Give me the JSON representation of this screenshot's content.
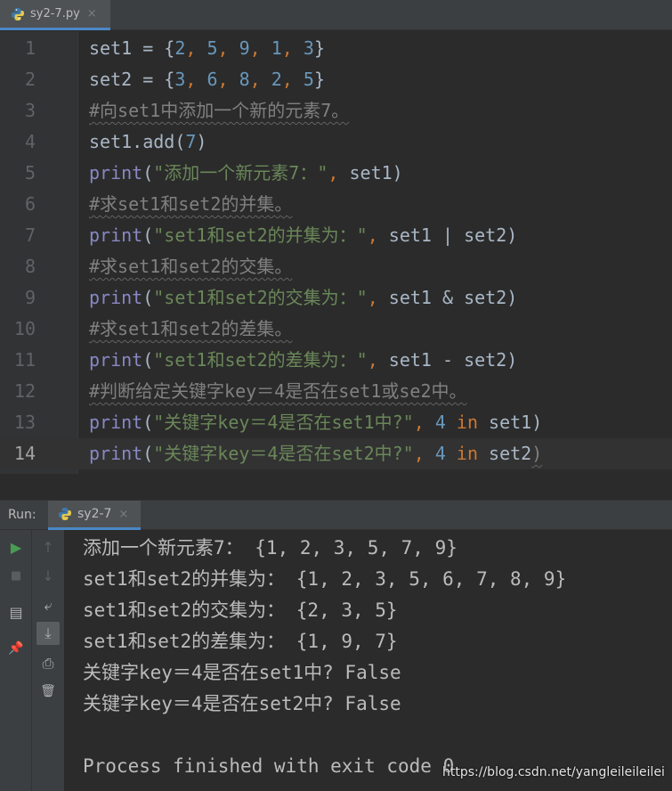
{
  "editor_tab": {
    "title": "sy2-7.py",
    "close": "×",
    "icon": "python-file-icon"
  },
  "code_lines": [
    {
      "num": "1"
    },
    {
      "num": "2"
    },
    {
      "num": "3"
    },
    {
      "num": "4"
    },
    {
      "num": "5"
    },
    {
      "num": "6"
    },
    {
      "num": "7"
    },
    {
      "num": "8"
    },
    {
      "num": "9"
    },
    {
      "num": "10"
    },
    {
      "num": "11"
    },
    {
      "num": "12"
    },
    {
      "num": "13"
    },
    {
      "num": "14"
    }
  ],
  "code": {
    "l1": {
      "a": "set1 = {",
      "n1": "2",
      "c1": ", ",
      "n2": "5",
      "c2": ", ",
      "n3": "9",
      "c3": ", ",
      "n4": "1",
      "c4": ", ",
      "n5": "3",
      "b": "}"
    },
    "l2": {
      "a": "set2 = {",
      "n1": "3",
      "c1": ", ",
      "n2": "6",
      "c2": ", ",
      "n3": "8",
      "c3": ", ",
      "n4": "2",
      "c4": ", ",
      "n5": "5",
      "b": "}"
    },
    "l3": {
      "comment": "#向set1中添加一个新的元素7。"
    },
    "l4": {
      "a": "set1.add(",
      "n": "7",
      "b": ")"
    },
    "l5": {
      "fn": "print",
      "p": "(",
      "s": "\"添加一个新元素7：\"",
      "k": ", ",
      "rest": "set1)"
    },
    "l6": {
      "comment": "#求set1和set2的并集。"
    },
    "l7": {
      "fn": "print",
      "p": "(",
      "s": "\"set1和set2的并集为：\"",
      "k": ", ",
      "rest": "set1 | set2)"
    },
    "l8": {
      "comment": "#求set1和set2的交集。"
    },
    "l9": {
      "fn": "print",
      "p": "(",
      "s": "\"set1和set2的交集为：\"",
      "k": ", ",
      "rest": "set1 & set2)"
    },
    "l10": {
      "comment": "#求set1和set2的差集。"
    },
    "l11": {
      "fn": "print",
      "p": "(",
      "s": "\"set1和set2的差集为：\"",
      "k": ", ",
      "rest": "set1 - set2)"
    },
    "l12": {
      "comment": "#判断给定关键字key＝4是否在set1或se2中。"
    },
    "l13": {
      "fn": "print",
      "p": "(",
      "s": "\"关键字key＝4是否在set1中?\"",
      "k": ", ",
      "n": "4",
      "sp": " ",
      "kw": "in",
      "rest": " set1)"
    },
    "l14": {
      "fn": "print",
      "p": "(",
      "s": "\"关键字key＝4是否在set2中?\"",
      "k": ", ",
      "n": "4",
      "sp": " ",
      "kw": "in",
      "rest": " set2",
      "close": ")"
    }
  },
  "run_panel": {
    "label": "Run:",
    "tab_title": "sy2-7",
    "close": "×",
    "output": [
      "添加一个新元素7： {1, 2, 3, 5, 7, 9}",
      "set1和set2的并集为： {1, 2, 3, 5, 6, 7, 8, 9}",
      "set1和set2的交集为： {2, 3, 5}",
      "set1和set2的差集为： {1, 9, 7}",
      "关键字key＝4是否在set1中? False",
      "关键字key＝4是否在set2中? False",
      "",
      "Process finished with exit code 0"
    ],
    "toolbar_left": [
      {
        "icon": "play-icon",
        "glyph": "▶",
        "color": "#499c54"
      },
      {
        "icon": "stop-icon",
        "glyph": "■",
        "color": "#5a5d5f"
      },
      {
        "icon": "layout-icon",
        "glyph": "▤",
        "color": "#afb1b3"
      },
      {
        "icon": "pin-icon",
        "glyph": "📌",
        "color": "#afb1b3"
      }
    ],
    "toolbar_right": [
      {
        "icon": "arrow-up-icon",
        "glyph": "↑",
        "color": "#5a5d5f"
      },
      {
        "icon": "arrow-down-icon",
        "glyph": "↓",
        "color": "#5a5d5f"
      },
      {
        "icon": "soft-wrap-icon",
        "glyph": "⤶",
        "color": "#afb1b3"
      },
      {
        "icon": "scroll-to-end-icon",
        "glyph": "⤓",
        "color": "#afb1b3"
      },
      {
        "icon": "print-icon",
        "glyph": "⎙",
        "color": "#afb1b3"
      },
      {
        "icon": "trash-icon",
        "glyph": "🗑",
        "color": "#afb1b3"
      }
    ]
  },
  "watermark": "https://blog.csdn.net/yangleileileilei"
}
